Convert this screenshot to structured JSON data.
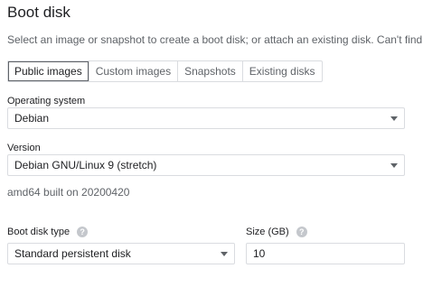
{
  "section": {
    "title": "Boot disk",
    "description": "Select an image or snapshot to create a boot disk; or attach an existing disk. Can't find"
  },
  "tabs": [
    {
      "label": "Public images",
      "active": true
    },
    {
      "label": "Custom images",
      "active": false
    },
    {
      "label": "Snapshots",
      "active": false
    },
    {
      "label": "Existing disks",
      "active": false
    }
  ],
  "operating_system": {
    "label": "Operating system",
    "value": "Debian"
  },
  "version": {
    "label": "Version",
    "value": "Debian GNU/Linux 9 (stretch)"
  },
  "build_info": "amd64 built on 20200420",
  "boot_disk_type": {
    "label": "Boot disk type",
    "value": "Standard persistent disk"
  },
  "size": {
    "label": "Size (GB)",
    "value": "10"
  },
  "icons": {
    "help": "help-icon",
    "dropdown": "chevron-down-icon"
  },
  "colors": {
    "text": "#202124",
    "secondary_text": "#5f6368",
    "border": "#dadce0",
    "help_icon": "#c4c7cc"
  }
}
